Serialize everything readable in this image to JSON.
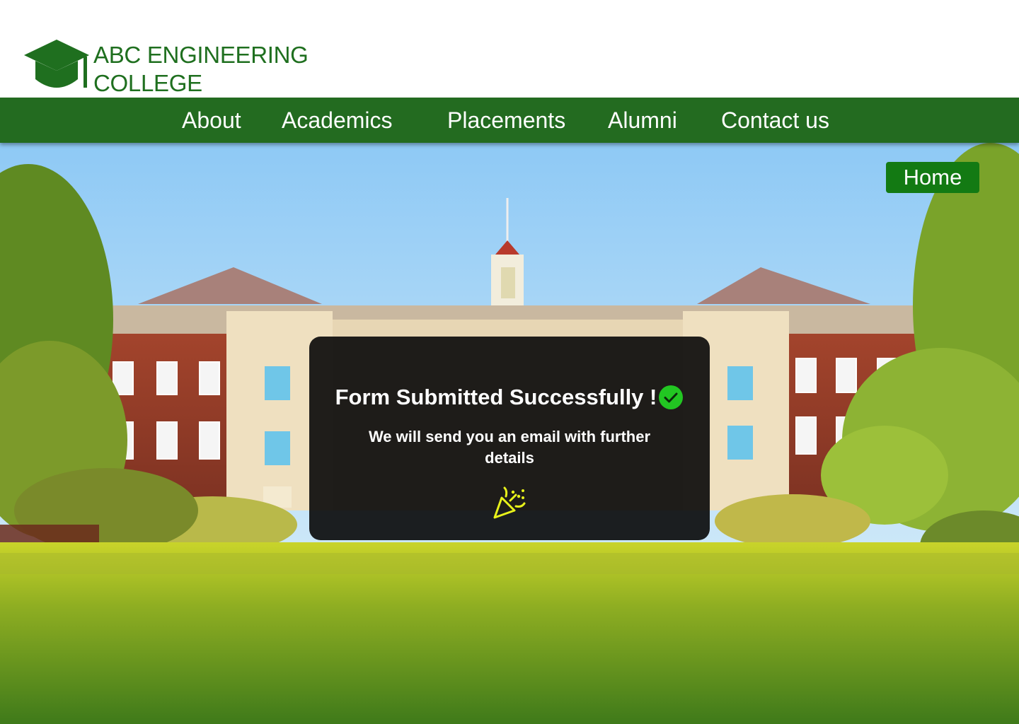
{
  "brand": {
    "line1": "ABC ENGINEERING",
    "line2": "COLLEGE",
    "logo_icon": "graduation-cap-icon",
    "color": "#1f6f1f"
  },
  "nav": {
    "background": "#236b20",
    "items": [
      {
        "label": "About"
      },
      {
        "label": "Academics"
      },
      {
        "label": "Placements"
      },
      {
        "label": "Alumni"
      },
      {
        "label": "Contact us"
      }
    ]
  },
  "home_button": {
    "label": "Home",
    "background": "#137a13"
  },
  "hero": {
    "image": "college-campus-photo"
  },
  "modal": {
    "title": "Form Submitted Successfully !",
    "message": "We will send you an email with further details",
    "status_icon": "check-circle-icon",
    "status_color": "#22c622",
    "decoration_icon": "party-popper-icon",
    "decoration_color": "#e8f21a"
  }
}
